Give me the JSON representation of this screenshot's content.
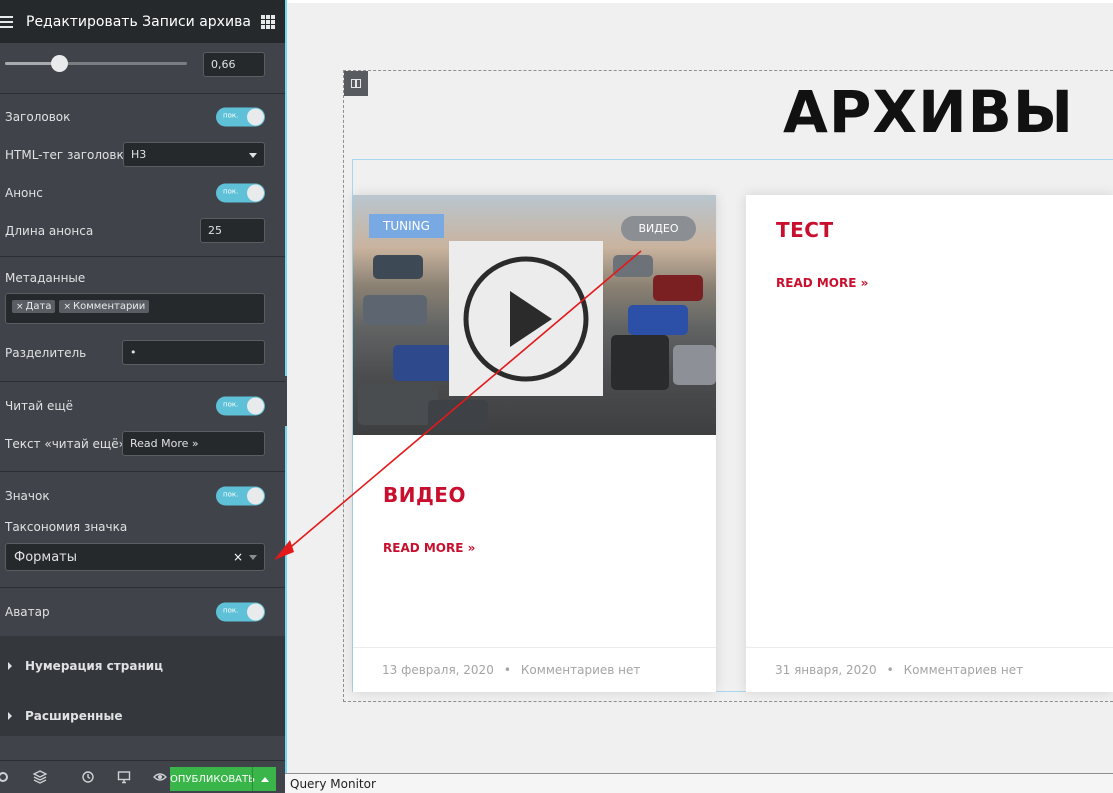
{
  "panel": {
    "title": "Редактировать Записи архива",
    "slider": {
      "value_text": "0,66",
      "fraction": 0.3
    },
    "toggle_text": "пок.",
    "fields": {
      "title_label": "Заголовок",
      "html_tag_label": "HTML-тег заголовка",
      "html_tag_value": "H3",
      "excerpt_label": "Анонс",
      "excerpt_length_label": "Длина анонса",
      "excerpt_length_value": "25",
      "meta_label": "Метаданные",
      "meta_tags": [
        "Дата",
        "Комментарии"
      ],
      "tag_remove_glyph": "×",
      "separator_label": "Разделитель",
      "separator_value": "•",
      "read_more_label": "Читай ещё",
      "read_more_text_label": "Текст «читай ещё»",
      "read_more_text_value": "Read More »",
      "badge_label": "Значок",
      "badge_taxonomy_label": "Таксономия значка",
      "badge_taxonomy_value": "Форматы",
      "badge_taxonomy_clear": "×",
      "avatar_label": "Аватар"
    },
    "sections": {
      "pagination": "Нумерация страниц",
      "advanced": "Расширенные"
    },
    "footer": {
      "publish_label": "ОПУБЛИКОВАТЬ"
    }
  },
  "canvas": {
    "heading": "АРХИВЫ",
    "posts": [
      {
        "title": "ВИДЕО",
        "read_more": "READ MORE »",
        "date": "13 февраля, 2020",
        "separator": "•",
        "comments": "Комментариев нет",
        "badge_category": "TUNING",
        "badge_format": "ВИДЕО"
      },
      {
        "title": "ТЕСТ",
        "read_more": "READ MORE »",
        "date": "31 января, 2020",
        "separator": "•",
        "comments": "Комментариев нет"
      }
    ]
  },
  "query_monitor": "Query Monitor",
  "colors": {
    "accent": "#c8102e",
    "toggle_on": "#5fc1d7",
    "publish": "#39b54a",
    "annotation_arrow": "#e3191b"
  }
}
